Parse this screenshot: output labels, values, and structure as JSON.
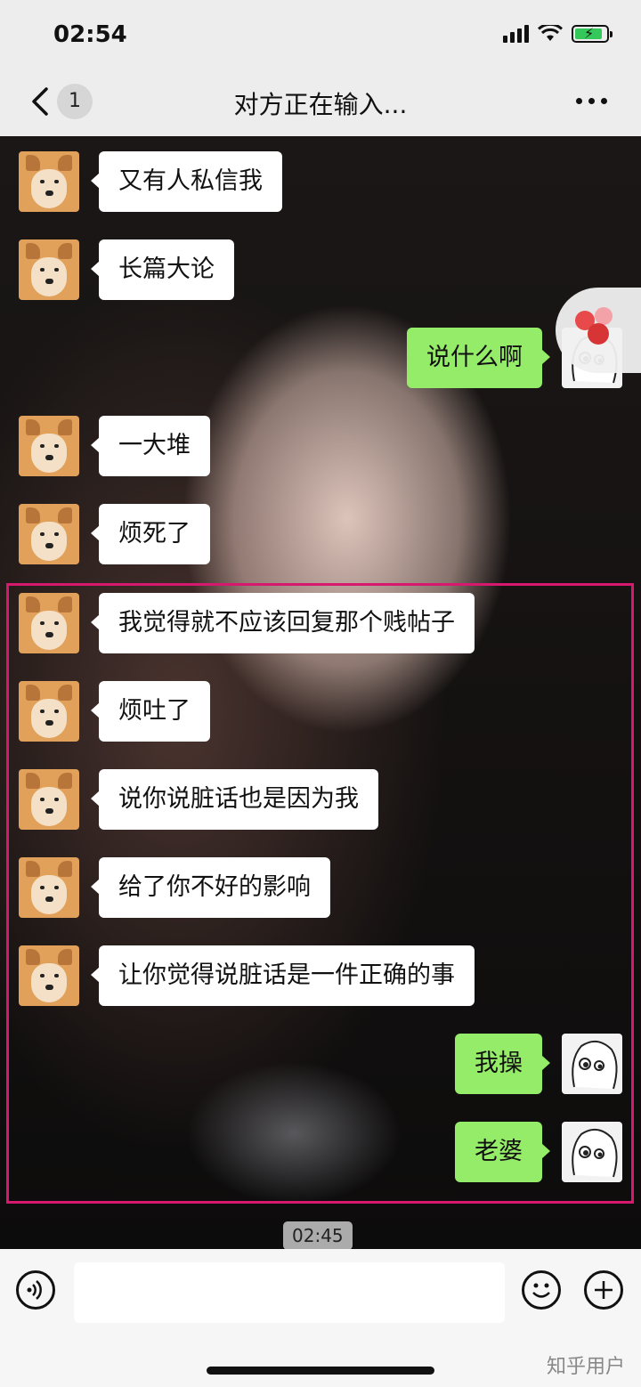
{
  "status_bar": {
    "time": "02:54"
  },
  "nav": {
    "back_badge": "1",
    "title": "对方正在输入..."
  },
  "messages": [
    {
      "side": "left",
      "text": "又有人私信我"
    },
    {
      "side": "left",
      "text": "长篇大论"
    },
    {
      "side": "right",
      "text": "说什么啊"
    },
    {
      "side": "left",
      "text": "一大堆"
    },
    {
      "side": "left",
      "text": "烦死了"
    },
    {
      "side": "left",
      "text": "我觉得就不应该回复那个贱帖子"
    },
    {
      "side": "left",
      "text": "烦吐了"
    },
    {
      "side": "left",
      "text": "说你说脏话也是因为我"
    },
    {
      "side": "left",
      "text": "给了你不好的影响"
    },
    {
      "side": "left",
      "text": "让你觉得说脏话是一件正确的事"
    },
    {
      "side": "right",
      "text": "我操"
    },
    {
      "side": "right",
      "text": "老婆"
    }
  ],
  "timestamp": "02:45",
  "watermark": "知乎用户",
  "icons": {
    "back": "chevron-left-icon",
    "more": "more-icon",
    "voice": "voice-icon",
    "emoji": "emoji-icon",
    "plus": "plus-icon",
    "float": "floating-ball-icon"
  },
  "colors": {
    "highlight": "#d6186f",
    "self_bubble": "#95ec69",
    "other_bubble": "#ffffff"
  }
}
